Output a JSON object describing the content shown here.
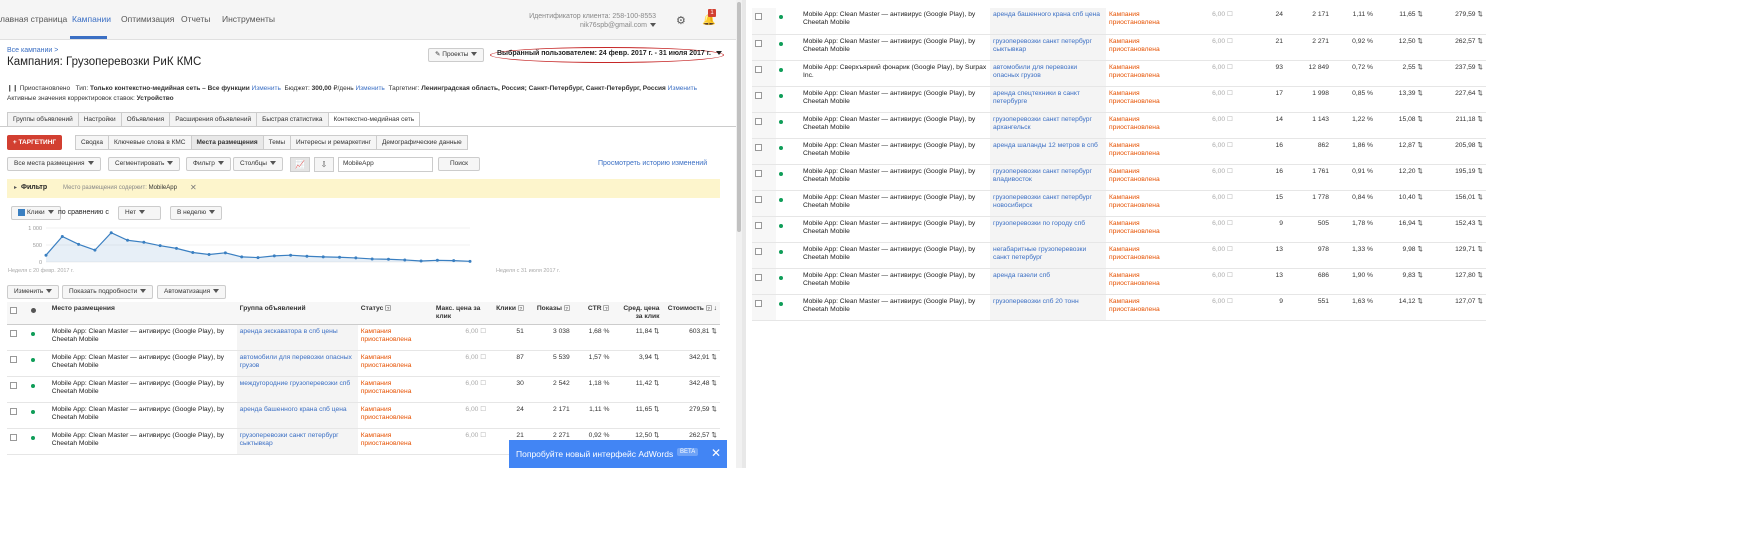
{
  "topnav": {
    "tabs": [
      "лавная страница",
      "Кампании",
      "Оптимизация",
      "Отчеты",
      "Инструменты"
    ],
    "client_id": "Идентификатор клиента: 258-100-8553",
    "email": "nik76spb@gmail.com",
    "notifications": "1"
  },
  "header": {
    "breadcrumb": "Все кампании >",
    "title": "Кампания: Грузоперевозки РиК КМС",
    "projects_label": "Проекты",
    "date_range": "Выбранный пользователем: 24 февр. 2017 г. - 31 июля 2017 г."
  },
  "status": {
    "paused": "Приостановлено",
    "type_label": "Тип:",
    "type_value": "Только контекстно-медийная сеть – Все функции",
    "edit": "Изменить",
    "budget_label": "Бюджет:",
    "budget_value": "300,00",
    "per_day": "/день",
    "targeting_label": "Таргетинг:",
    "targeting_value": "Ленинградская область, Россия; Санкт-Петербург, Санкт-Петербург, Россия",
    "bid_adj_label": "Активные значения корректировок ставок:",
    "bid_adj_value": "Устройство"
  },
  "tabs": [
    "Группы объявлений",
    "Настройки",
    "Объявления",
    "Расширения объявлений",
    "Быстрая статистика",
    "Контекстно-медийная сеть"
  ],
  "subtabs": {
    "targeting_button": "+ ТАРГЕТИНГ",
    "items": [
      "Сводка",
      "Ключевые слова в КМС",
      "Места размещения",
      "Темы",
      "Интересы и ремаркетинг",
      "Демографические данные"
    ]
  },
  "toolbar": {
    "all_placements": "Все места размещения",
    "segment": "Сегментировать",
    "filter": "Фильтр",
    "columns": "Столбцы",
    "search_value": "MobileApp",
    "search_button": "Поиск",
    "history_link": "Просмотреть историю изменений"
  },
  "filter_bar": {
    "label": "Фильтр",
    "description_prefix": "Место размещения содержит:",
    "description_value": "MobileApp"
  },
  "chart_controls": {
    "metric": "Клики",
    "compare_label": "по сравнению с",
    "compare_value": "Нет",
    "period": "В неделю"
  },
  "chart_data": {
    "type": "line",
    "yticks": [
      "1 000",
      "500",
      "0"
    ],
    "ylim": [
      0,
      1000
    ],
    "x_start_label": "Неделя с 20 февр. 2017 г.",
    "x_end_label": "Неделя с 31 июля 2017 г.",
    "series": [
      {
        "values": [
          200,
          750,
          520,
          350,
          860,
          640,
          580,
          480,
          400,
          280,
          220,
          270,
          150,
          130,
          180,
          200,
          170,
          150,
          140,
          120,
          90,
          80,
          60,
          30,
          50,
          40,
          20
        ]
      }
    ],
    "color": "#3a7fc1"
  },
  "table_tools": {
    "edit": "Изменить",
    "details": "Показать подробности",
    "automation": "Автоматизация"
  },
  "table": {
    "headers": [
      "Место размещения",
      "Группа объявлений",
      "Статус",
      "Макс. цена за клик",
      "Клики",
      "Показы",
      "CTR",
      "Сред. цена за клик",
      "Стоимость"
    ],
    "rows": [
      {
        "placement": "Mobile App: Clean Master — антивирус (Google Play), by Cheetah Mobile",
        "group": "аренда экскаватора в спб цены",
        "status": "Кампания приостановлена",
        "bid": "6,00",
        "clicks": "51",
        "impr": "3 038",
        "ctr": "1,68 %",
        "avg": "11,84",
        "cost": "603,81"
      },
      {
        "placement": "Mobile App: Clean Master — антивирус (Google Play), by Cheetah Mobile",
        "group": "автомобили для перевозки опасных грузов",
        "status": "Кампания приостановлена",
        "bid": "6,00",
        "clicks": "87",
        "impr": "5 539",
        "ctr": "1,57 %",
        "avg": "3,94",
        "cost": "342,91"
      },
      {
        "placement": "Mobile App: Clean Master — антивирус (Google Play), by Cheetah Mobile",
        "group": "междугородние грузоперевозки спб",
        "status": "Кампания приостановлена",
        "bid": "6,00",
        "clicks": "30",
        "impr": "2 542",
        "ctr": "1,18 %",
        "avg": "11,42",
        "cost": "342,48"
      },
      {
        "placement": "Mobile App: Clean Master — антивирус (Google Play), by Cheetah Mobile",
        "group": "аренда башенного крана спб цена",
        "status": "Кампания приостановлена",
        "bid": "6,00",
        "clicks": "24",
        "impr": "2 171",
        "ctr": "1,11 %",
        "avg": "11,65",
        "cost": "279,59"
      },
      {
        "placement": "Mobile App: Clean Master — антивирус (Google Play), by Cheetah Mobile",
        "group": "грузоперевозки санкт петербург сыктывкар",
        "status": "Кампания приостановлена",
        "bid": "6,00",
        "clicks": "21",
        "impr": "2 271",
        "ctr": "0,92 %",
        "avg": "12,50",
        "cost": "262,57"
      }
    ]
  },
  "promo": {
    "text": "Попробуйте новый интерфейс AdWords",
    "badge": "BETA"
  },
  "right_table": {
    "rows": [
      {
        "placement": "Mobile App: Clean Master — антивирус (Google Play), by Cheetah Mobile",
        "group": "аренда башенного крана спб цена",
        "status": "Кампания приостановлена",
        "bid": "6,00",
        "clicks": "24",
        "impr": "2 171",
        "ctr": "1,11 %",
        "avg": "11,65",
        "cost": "279,59"
      },
      {
        "placement": "Mobile App: Clean Master — антивирус (Google Play), by Cheetah Mobile",
        "group": "грузоперевозки санкт петербург сыктывкар",
        "status": "Кампания приостановлена",
        "bid": "6,00",
        "clicks": "21",
        "impr": "2 271",
        "ctr": "0,92 %",
        "avg": "12,50",
        "cost": "262,57"
      },
      {
        "placement": "Mobile App: Сверхъяркий фонарик (Google Play), by Surpax Inc.",
        "group": "автомобили для перевозки опасных грузов",
        "status": "Кампания приостановлена",
        "bid": "6,00",
        "clicks": "93",
        "impr": "12 849",
        "ctr": "0,72 %",
        "avg": "2,55",
        "cost": "237,59"
      },
      {
        "placement": "Mobile App: Clean Master — антивирус (Google Play), by Cheetah Mobile",
        "group": "аренда спецтехники в санкт петербурге",
        "status": "Кампания приостановлена",
        "bid": "6,00",
        "clicks": "17",
        "impr": "1 998",
        "ctr": "0,85 %",
        "avg": "13,39",
        "cost": "227,64"
      },
      {
        "placement": "Mobile App: Clean Master — антивирус (Google Play), by Cheetah Mobile",
        "group": "грузоперевозки санкт петербург архангельск",
        "status": "Кампания приостановлена",
        "bid": "6,00",
        "clicks": "14",
        "impr": "1 143",
        "ctr": "1,22 %",
        "avg": "15,08",
        "cost": "211,18"
      },
      {
        "placement": "Mobile App: Clean Master — антивирус (Google Play), by Cheetah Mobile",
        "group": "аренда шаланды 12 метров в спб",
        "status": "Кампания приостановлена",
        "bid": "6,00",
        "clicks": "16",
        "impr": "862",
        "ctr": "1,86 %",
        "avg": "12,87",
        "cost": "205,98"
      },
      {
        "placement": "Mobile App: Clean Master — антивирус (Google Play), by Cheetah Mobile",
        "group": "грузоперевозки санкт петербург владивосток",
        "status": "Кампания приостановлена",
        "bid": "6,00",
        "clicks": "16",
        "impr": "1 761",
        "ctr": "0,91 %",
        "avg": "12,20",
        "cost": "195,19"
      },
      {
        "placement": "Mobile App: Clean Master — антивирус (Google Play), by Cheetah Mobile",
        "group": "грузоперевозки санкт петербург новосибирск",
        "status": "Кампания приостановлена",
        "bid": "6,00",
        "clicks": "15",
        "impr": "1 778",
        "ctr": "0,84 %",
        "avg": "10,40",
        "cost": "156,01"
      },
      {
        "placement": "Mobile App: Clean Master — антивирус (Google Play), by Cheetah Mobile",
        "group": "грузоперевозки по городу спб",
        "status": "Кампания приостановлена",
        "bid": "6,00",
        "clicks": "9",
        "impr": "505",
        "ctr": "1,78 %",
        "avg": "16,94",
        "cost": "152,43"
      },
      {
        "placement": "Mobile App: Clean Master — антивирус (Google Play), by Cheetah Mobile",
        "group": "негабаритные грузоперевозки санкт петербург",
        "status": "Кампания приостановлена",
        "bid": "6,00",
        "clicks": "13",
        "impr": "978",
        "ctr": "1,33 %",
        "avg": "9,98",
        "cost": "129,71"
      },
      {
        "placement": "Mobile App: Clean Master — антивирус (Google Play), by Cheetah Mobile",
        "group": "аренда газели спб",
        "status": "Кампания приостановлена",
        "bid": "6,00",
        "clicks": "13",
        "impr": "686",
        "ctr": "1,90 %",
        "avg": "9,83",
        "cost": "127,80"
      },
      {
        "placement": "Mobile App: Clean Master — антивирус (Google Play), by Cheetah Mobile",
        "group": "грузоперевозки спб 20 тонн",
        "status": "Кампания приостановлена",
        "bid": "6,00",
        "clicks": "9",
        "impr": "551",
        "ctr": "1,63 %",
        "avg": "14,12",
        "cost": "127,07"
      }
    ]
  }
}
